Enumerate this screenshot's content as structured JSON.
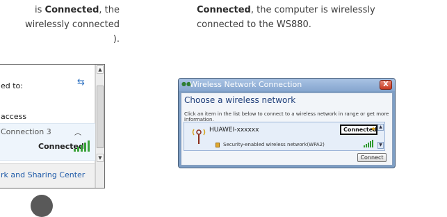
{
  "left_text": {
    "line1_prefix": "is ",
    "line1_bold": "Connected",
    "line1_suffix": ", the",
    "line2": "wirelessly connected",
    "line3": ")."
  },
  "right_text": {
    "bold": "Connected",
    "line1_suffix": ", the computer is wirelessly",
    "line2": "connected to the WS880."
  },
  "left_panel": {
    "connected_to": "ed to:",
    "access": "access",
    "connection_name": "Connection 3",
    "status": "Connected",
    "footer_link": "rk and Sharing Center"
  },
  "dialog": {
    "title": "Wireless Network Connection",
    "heading": "Choose a wireless network",
    "description": "Click an item in the list below to connect to a wireless network in range or get more information.",
    "network": {
      "ssid": "HUAWEI-xxxxxx",
      "security": "Security-enabled wireless network(WPA2)",
      "status": "Connected"
    },
    "connect_label": "Connect",
    "close_glyph": "X"
  },
  "icons": {
    "refresh": "refresh-icon",
    "signal": "signal-bars-icon",
    "wifi": "wifi-antenna-icon",
    "star": "star-icon",
    "lock": "lock-icon"
  },
  "colors": {
    "link": "#1e5aa8",
    "dialog_frame": "#7d9ec5",
    "signal_green": "#2e9a2e"
  }
}
